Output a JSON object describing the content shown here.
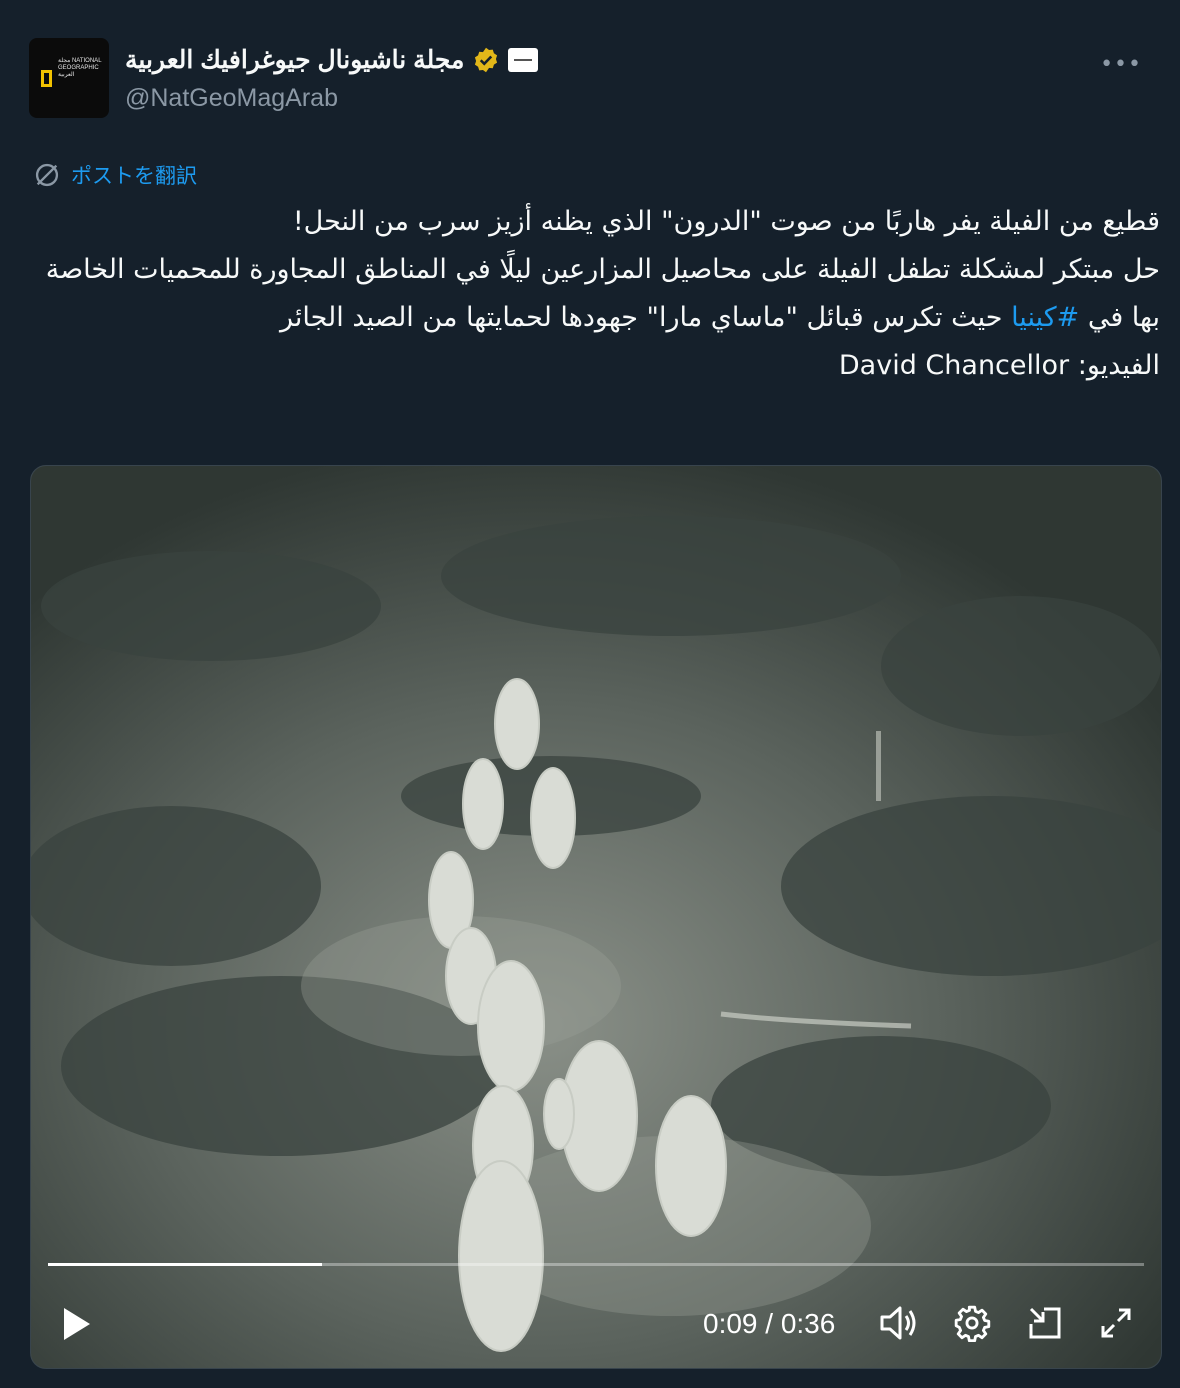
{
  "account": {
    "display_name": "مجلة ناشيونال جيوغرافيك العربية",
    "handle": "@NatGeoMagArab",
    "avatar_text": "مجلة NATIONAL GEOGRAPHIC العربية"
  },
  "more_label": "•••",
  "translate_label": "ポストを翻訳",
  "tweet": {
    "line1": "قطيع من الفيلة يفر هاربًا من صوت \"الدرون\" الذي يظنه أزيز سرب من النحل!",
    "line2": "حل مبتكر لمشكلة تطفل الفيلة على محاصيل المزارعين ليلًا في المناطق المجاورة للمحميات الخاصة بها في ",
    "hashtag": "#كينيا",
    "line2_rest": " حيث تكرس قبائل \"ماساي مارا\" جهودها لحمايتها من الصيد الجائر",
    "credit_label": "الفيديو: ",
    "credit_name": "David Chancellor"
  },
  "video": {
    "time_display": "0:09 / 0:36",
    "progress": 0.25
  },
  "colors": {
    "background": "#15202b",
    "link": "#1d9bf0",
    "verified": "#e2b719",
    "muted": "#8b98a5"
  }
}
